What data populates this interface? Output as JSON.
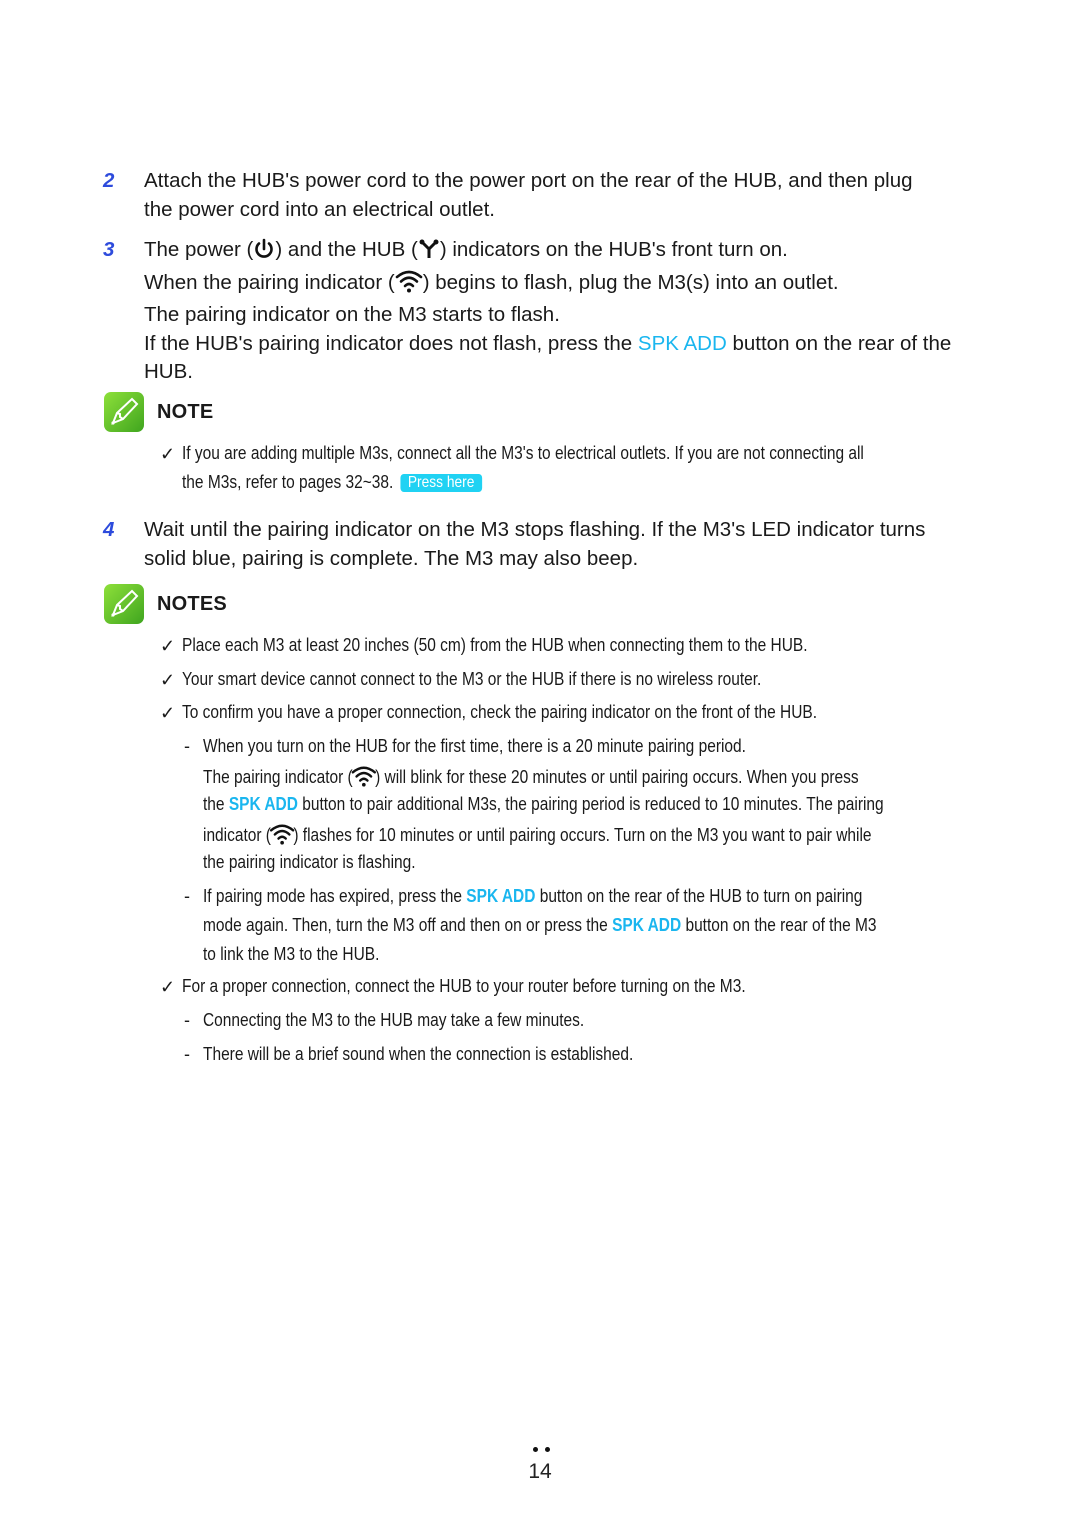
{
  "steps": [
    {
      "number": "2",
      "line1": "Attach the HUB's power cord to the power port on the rear of the HUB, and then plug",
      "line2": "the power cord into an electrical outlet."
    },
    {
      "number": "3",
      "line1_a": "The power (",
      "line1_b": ") and the HUB (",
      "line1_c": ") indicators on the HUB's front turn on.",
      "line2_a": "When the pairing indicator (",
      "line2_b": ") begins to flash, plug the M3(s) into an outlet.",
      "line3": "The pairing indicator on the M3 starts to flash.",
      "line4_a": "If the HUB's pairing indicator does not flash, press the ",
      "line4_accent": "SPK ADD",
      "line4_b": " button on the rear of the",
      "line5": "HUB."
    },
    {
      "number": "4",
      "line1": "Wait until the pairing indicator on the M3 stops flashing. If the M3's LED indicator turns",
      "line2": "solid blue, pairing is complete. The M3 may also beep."
    }
  ],
  "note1": {
    "title": "NOTE",
    "bullet": "✓",
    "line1": "If you are adding multiple M3s, connect all the M3's to electrical outlets. If you are not connecting all",
    "line2": "the M3s, refer to pages 32~38.",
    "link_label": "Press here"
  },
  "note2": {
    "title": "NOTES",
    "bullet": "✓",
    "dash": "-",
    "items": [
      "Place each M3 at least 20 inches (50 cm) from the HUB when connecting them to the HUB.",
      "Your smart device cannot connect to the M3 or the HUB if there is no wireless router.",
      "To confirm you have a proper connection, check the pairing indicator on the front of the HUB."
    ],
    "sub1": {
      "line1": "When you turn on the HUB for the first time, there is a 20 minute pairing period.",
      "line2_a": "The pairing indicator (",
      "line2_b": ") will blink for these 20 minutes or until pairing occurs. When you press",
      "line3_a": "the ",
      "line3_accent": "SPK ADD",
      "line3_b": " button to pair additional M3s, the pairing period is reduced to 10 minutes. The pairing",
      "line4_a": "indicator (",
      "line4_b": ") flashes for 10 minutes or until pairing occurs. Turn on the M3 you want to pair while",
      "line5": "the pairing indicator is flashing."
    },
    "sub2": {
      "line1_a": "If pairing mode has expired, press the ",
      "line1_accent": "SPK ADD",
      "line1_b": " button on the rear of the HUB to turn on pairing",
      "line2_a": "mode again. Then, turn the M3 off and then on or press the ",
      "line2_accent": "SPK ADD",
      "line2_b": " button on the rear of the M3",
      "line3": "to link the M3 to the HUB."
    },
    "item4": "For a proper connection, connect the HUB to your router before turning on the M3.",
    "sub3": "Connecting the M3 to the HUB may take a few minutes.",
    "sub4": "There will be a brief sound when the connection is established."
  },
  "footer": {
    "page_number": "14"
  },
  "colors": {
    "step_number": "#2d4bdc",
    "accent": "#1ab6ef",
    "press_here_bg": "#20d2f3",
    "note_icon": "#5cc22a"
  }
}
